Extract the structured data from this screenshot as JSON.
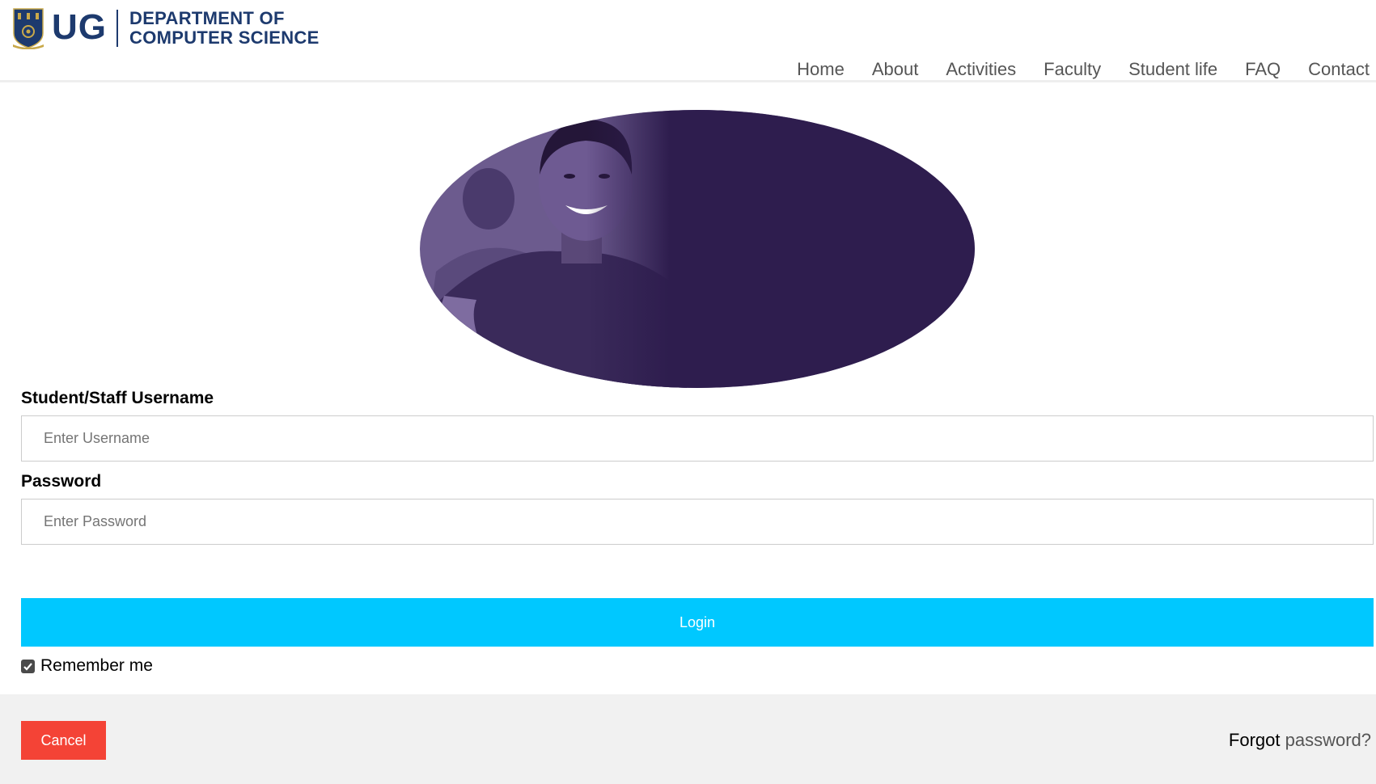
{
  "header": {
    "logo_short": "UG",
    "logo_line1": "DEPARTMENT OF",
    "logo_line2": "COMPUTER SCIENCE",
    "brand_color": "#1d3a6e",
    "nav": [
      "Home",
      "About",
      "Activities",
      "Faculty",
      "Student life",
      "FAQ",
      "Contact"
    ]
  },
  "hero": {
    "image": "smiling-student-photo",
    "tint_color": "#2e1d4e"
  },
  "form": {
    "username_label": "Student/Staff Username",
    "username_placeholder": "Enter Username",
    "username_value": "",
    "password_label": "Password",
    "password_placeholder": "Enter Password",
    "password_value": "",
    "login_label": "Login",
    "login_color": "#00c8ff",
    "remember_label": "Remember me",
    "remember_checked": true
  },
  "footer": {
    "cancel_label": "Cancel",
    "cancel_color": "#f44336",
    "forgot_prefix": "Forgot",
    "forgot_link": "password?"
  }
}
